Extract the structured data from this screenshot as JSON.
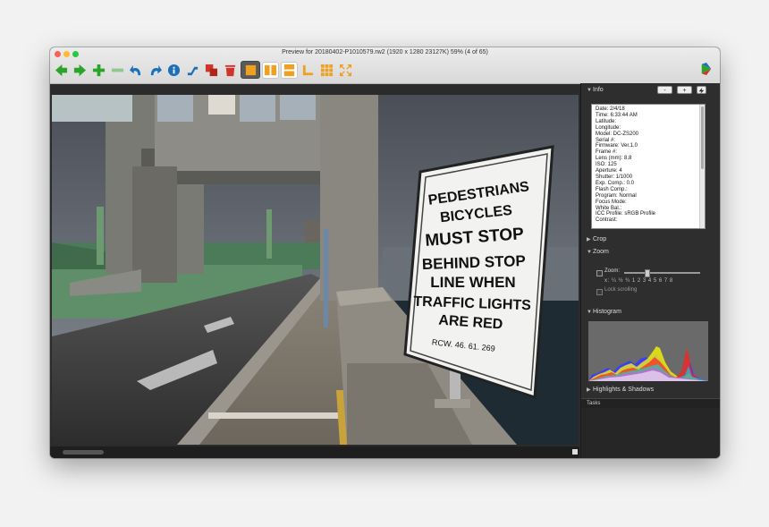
{
  "window": {
    "title": "Preview for 20180402-P1010579.rw2 (1920 x 1280 23127K) 59% (4 of 65)"
  },
  "toolbar": {
    "buttons": [
      {
        "name": "back-icon",
        "color": "#2aa52a"
      },
      {
        "name": "forward-icon",
        "color": "#2aa52a"
      },
      {
        "name": "add-icon",
        "color": "#2aa52a"
      },
      {
        "name": "remove-icon",
        "color": "#8fc88f"
      },
      {
        "name": "undo-icon",
        "color": "#1d6fb8"
      },
      {
        "name": "redo-icon",
        "color": "#1d6fb8"
      },
      {
        "name": "info-icon",
        "color": "#1d6fb8"
      },
      {
        "name": "adjust-icon",
        "color": "#1d6fb8"
      },
      {
        "name": "copy-icon",
        "color": "#d0342c"
      },
      {
        "name": "trash-icon",
        "color": "#d0342c"
      },
      {
        "name": "single-view-icon",
        "color": "#f0a020"
      },
      {
        "name": "split-vertical-icon",
        "color": "#f0a020"
      },
      {
        "name": "split-horizontal-icon",
        "color": "#f0a020"
      },
      {
        "name": "crop-icon",
        "color": "#f0a020"
      },
      {
        "name": "grid-view-icon",
        "color": "#f0a020"
      },
      {
        "name": "expand-icon",
        "color": "#f0a020"
      }
    ]
  },
  "sign": {
    "lines": [
      "PEDESTRIANS",
      "BICYCLES",
      "MUST STOP",
      "BEHIND STOP",
      "LINE WHEN",
      "TRAFFIC LIGHTS",
      "ARE RED"
    ],
    "code": "RCW. 46. 61. 269"
  },
  "inspector": {
    "info": {
      "title": "Info",
      "minus_label": "-",
      "plus_label": "+",
      "lines": [
        "Date: 2/4/18",
        "Time: 6:33:44 AM",
        "Latitude:",
        "Longitude:",
        "Model: DC-ZS200",
        "Serial #:",
        "Firmware: Ver.1.0",
        "Frame #:",
        "Lens (mm): 8.8",
        "ISO: 125",
        "Aperture: 4",
        "Shutter: 1/1000",
        "Exp. Comp.: 0.0",
        "Flash Comp.:",
        "Program: Normal",
        "Focus Mode:",
        "White Bal.:",
        "ICC Profile: sRGB Profile",
        "Contrast:"
      ]
    },
    "crop": {
      "title": "Crop"
    },
    "zoom": {
      "title": "Zoom",
      "label": "Zoom:",
      "scale": "x:  ¼ ½ ¾  1  2  3  4  5  6  7  8",
      "lock_label": "Lock scrolling"
    },
    "histogram": {
      "title": "Histogram"
    },
    "highlights": {
      "title": "Highlights & Shadows"
    },
    "tasks": {
      "title": "Tasks"
    }
  }
}
